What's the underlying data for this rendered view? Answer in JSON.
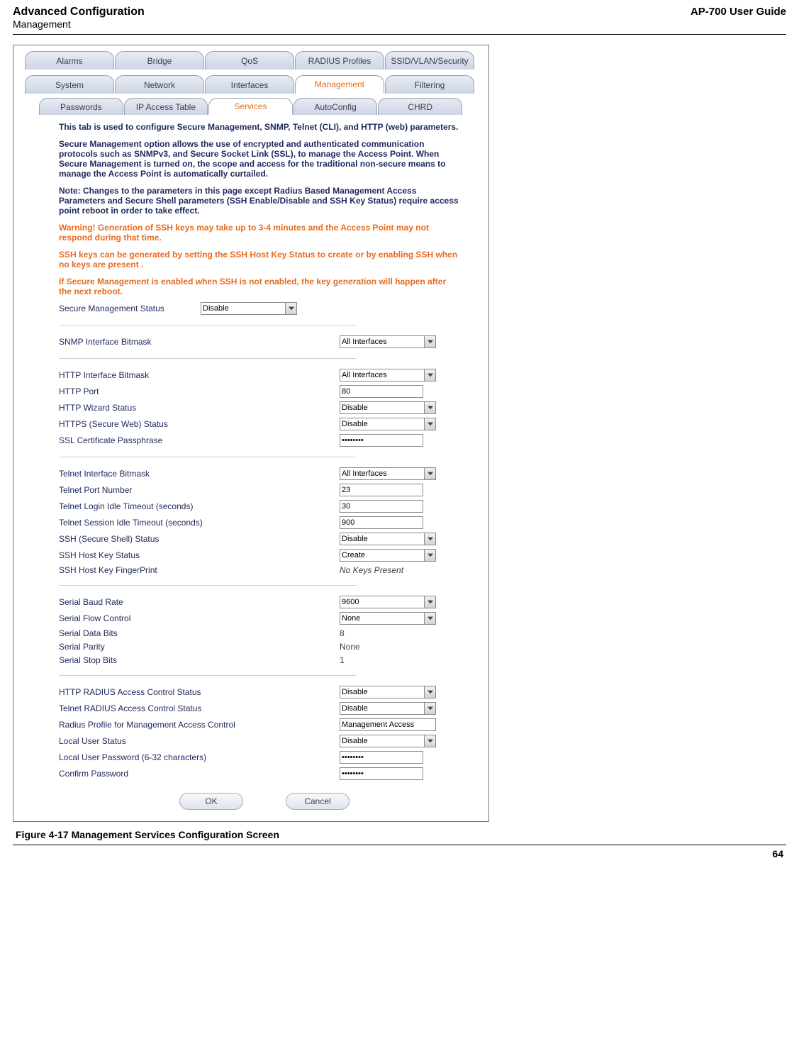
{
  "header": {
    "title": "Advanced Configuration",
    "subtitle": "Management",
    "guide": "AP-700 User Guide"
  },
  "topTabs": {
    "row1": [
      "Alarms",
      "Bridge",
      "QoS",
      "RADIUS Profiles",
      "SSID/VLAN/Security"
    ],
    "row2": [
      "System",
      "Network",
      "Interfaces",
      "Management",
      "Filtering"
    ],
    "row2_active": "Management"
  },
  "subTabs": {
    "items": [
      "Passwords",
      "IP Access Table",
      "Services",
      "AutoConfig",
      "CHRD"
    ],
    "active": "Services"
  },
  "blurbs": {
    "p1": "This tab is used to configure Secure Management, SNMP, Telnet (CLI), and HTTP (web) parameters.",
    "p2": "Secure Management option allows the use of encrypted and authenticated communication protocols such as SNMPv3, and Secure Socket Link (SSL), to manage the Access Point. When Secure Management is turned on, the scope and access for the traditional non-secure means to manage the Access Point is automatically curtailed.",
    "p3": "Note: Changes to the parameters in this page except Radius Based Management Access Parameters and Secure Shell parameters (SSH Enable/Disable and SSH Key Status) require access point reboot in order to take effect.",
    "p4": "Warning! Generation of SSH keys may take up to 3-4 minutes and the Access Point may not respond during that time.",
    "p5": "SSH keys can be generated by setting the SSH Host Key Status to create or by enabling SSH when no keys are present .",
    "p6": "If Secure Management is enabled when SSH is not enabled, the key generation will happen after the next reboot."
  },
  "fields": {
    "secureManagementStatus": {
      "label": "Secure Management Status",
      "value": "Disable"
    },
    "snmpInterfaceBitmask": {
      "label": "SNMP Interface Bitmask",
      "value": "All Interfaces"
    },
    "httpInterfaceBitmask": {
      "label": "HTTP Interface Bitmask",
      "value": "All Interfaces"
    },
    "httpPort": {
      "label": "HTTP Port",
      "value": "80"
    },
    "httpWizardStatus": {
      "label": "HTTP Wizard Status",
      "value": "Disable"
    },
    "httpsStatus": {
      "label": "HTTPS (Secure Web) Status",
      "value": "Disable"
    },
    "sslPassphrase": {
      "label": "SSL Certificate Passphrase",
      "value": "********"
    },
    "telnetInterfaceBitmask": {
      "label": "Telnet Interface Bitmask",
      "value": "All Interfaces"
    },
    "telnetPort": {
      "label": "Telnet Port Number",
      "value": "23"
    },
    "telnetLoginIdle": {
      "label": "Telnet Login Idle Timeout (seconds)",
      "value": "30"
    },
    "telnetSessionIdle": {
      "label": "Telnet Session Idle Timeout (seconds)",
      "value": "900"
    },
    "sshStatus": {
      "label": "SSH (Secure Shell) Status",
      "value": "Disable"
    },
    "sshHostKeyStatus": {
      "label": "SSH Host Key Status",
      "value": "Create"
    },
    "sshFingerprint": {
      "label": "SSH Host Key FingerPrint",
      "value": "No Keys Present"
    },
    "serialBaud": {
      "label": "Serial Baud Rate",
      "value": "9600"
    },
    "serialFlow": {
      "label": "Serial Flow Control",
      "value": "None"
    },
    "serialDataBits": {
      "label": "Serial Data Bits",
      "value": "8"
    },
    "serialParity": {
      "label": "Serial Parity",
      "value": "None"
    },
    "serialStopBits": {
      "label": "Serial Stop Bits",
      "value": "1"
    },
    "httpRadius": {
      "label": "HTTP RADIUS Access Control Status",
      "value": "Disable"
    },
    "telnetRadius": {
      "label": "Telnet RADIUS Access Control Status",
      "value": "Disable"
    },
    "radiusProfile": {
      "label": "Radius Profile for Management Access Control",
      "value": "Management Access"
    },
    "localUserStatus": {
      "label": "Local User Status",
      "value": "Disable"
    },
    "localUserPwd": {
      "label": "Local User Password (6-32 characters)",
      "value": "********"
    },
    "confirmPwd": {
      "label": "Confirm Password",
      "value": "********"
    }
  },
  "buttons": {
    "ok": "OK",
    "cancel": "Cancel"
  },
  "caption": "Figure 4-17 Management Services Configuration Screen",
  "pageNumber": "64"
}
